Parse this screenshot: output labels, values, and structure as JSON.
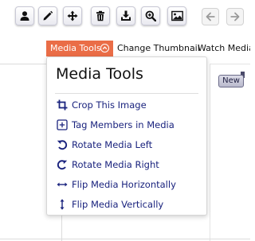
{
  "toolbar": {
    "buttons": [
      {
        "icon": "user-icon"
      },
      {
        "icon": "pencil-icon"
      },
      {
        "icon": "move-icon"
      },
      {
        "icon": "trash-icon"
      },
      {
        "icon": "download-icon"
      },
      {
        "icon": "zoom-icon"
      },
      {
        "icon": "image-icon"
      }
    ],
    "nav": [
      {
        "icon": "arrow-left-icon"
      },
      {
        "icon": "arrow-right-icon"
      }
    ]
  },
  "tabs": {
    "media_tools": "Media Tools",
    "change_thumbnail": "Change Thumbnail",
    "watch_media": "Watch Media"
  },
  "badge": {
    "new": "New"
  },
  "dropdown": {
    "title": "Media Tools",
    "items": [
      {
        "label": "Crop This Image",
        "icon": "crop-icon"
      },
      {
        "label": "Tag Members in Media",
        "icon": "plus-box-icon"
      },
      {
        "label": "Rotate Media Left",
        "icon": "rotate-left-icon"
      },
      {
        "label": "Rotate Media Right",
        "icon": "rotate-right-icon"
      },
      {
        "label": "Flip Media Horizontally",
        "icon": "flip-horizontal-icon"
      },
      {
        "label": "Flip Media Vertically",
        "icon": "flip-vertical-icon"
      }
    ]
  },
  "colors": {
    "accent": "#ea6d47",
    "link": "#1a237e"
  }
}
